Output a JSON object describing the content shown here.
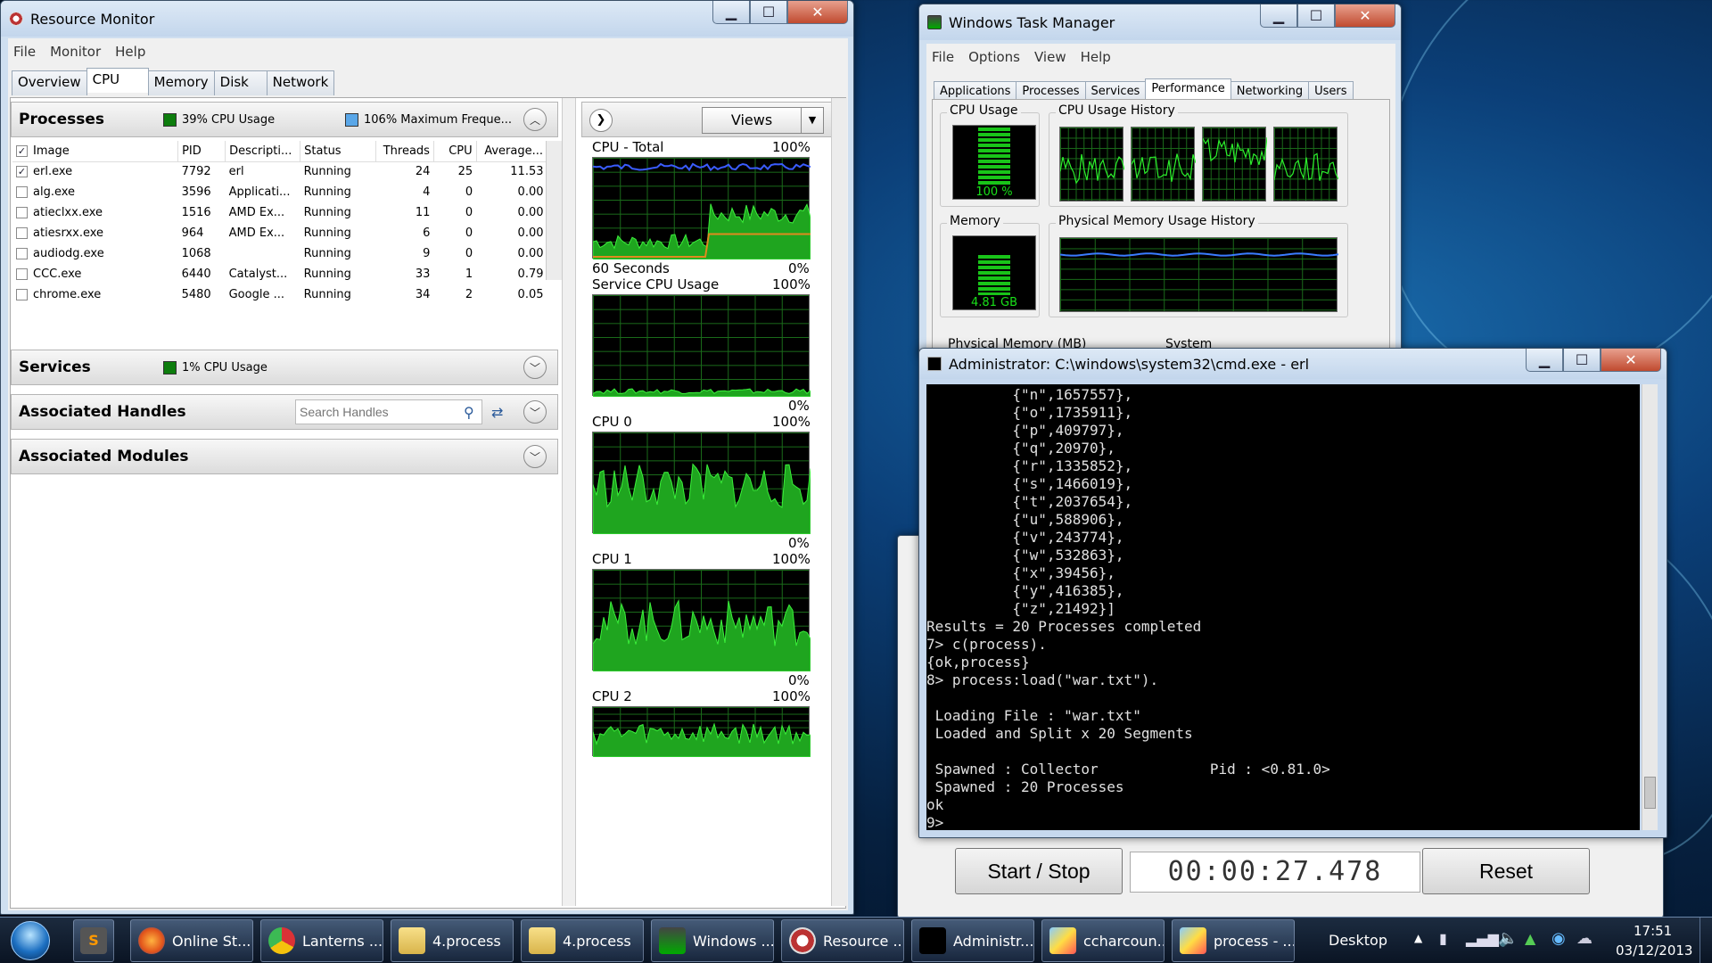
{
  "colors": {
    "accent_green": "#19c419",
    "graph_orange": "#e08a1e",
    "graph_blue": "#3a5cff",
    "cpu_legend_green": "#0d7d0d",
    "freq_legend_blue": "#5aa7e8"
  },
  "resmon": {
    "title": "Resource Monitor",
    "menu": [
      "File",
      "Monitor",
      "Help"
    ],
    "tabs": [
      "Overview",
      "CPU",
      "Memory",
      "Disk",
      "Network"
    ],
    "processes": {
      "heading": "Processes",
      "cpu_usage": "39% CPU Usage",
      "max_freq": "106% Maximum Freque...",
      "columns": [
        "Image",
        "PID",
        "Descripti...",
        "Status",
        "Threads",
        "CPU",
        "Average..."
      ],
      "rows": [
        {
          "checked": true,
          "image": "erl.exe",
          "pid": "7792",
          "desc": "erl",
          "status": "Running",
          "threads": "24",
          "cpu": "25",
          "avg": "11.53"
        },
        {
          "checked": false,
          "image": "alg.exe",
          "pid": "3596",
          "desc": "Applicati...",
          "status": "Running",
          "threads": "4",
          "cpu": "0",
          "avg": "0.00"
        },
        {
          "checked": false,
          "image": "atieclxx.exe",
          "pid": "1516",
          "desc": "AMD Ex...",
          "status": "Running",
          "threads": "11",
          "cpu": "0",
          "avg": "0.00"
        },
        {
          "checked": false,
          "image": "atiesrxx.exe",
          "pid": "964",
          "desc": "AMD Ex...",
          "status": "Running",
          "threads": "6",
          "cpu": "0",
          "avg": "0.00"
        },
        {
          "checked": false,
          "image": "audiodg.exe",
          "pid": "1068",
          "desc": "",
          "status": "Running",
          "threads": "9",
          "cpu": "0",
          "avg": "0.00"
        },
        {
          "checked": false,
          "image": "CCC.exe",
          "pid": "6440",
          "desc": "Catalyst...",
          "status": "Running",
          "threads": "33",
          "cpu": "1",
          "avg": "0.79"
        },
        {
          "checked": false,
          "image": "chrome.exe",
          "pid": "5480",
          "desc": "Google ...",
          "status": "Running",
          "threads": "34",
          "cpu": "2",
          "avg": "0.05"
        }
      ]
    },
    "services": {
      "heading": "Services",
      "cpu_usage": "1% CPU Usage"
    },
    "handles": {
      "heading": "Associated Handles",
      "search_placeholder": "Search Handles"
    },
    "modules": {
      "heading": "Associated Modules"
    },
    "views_label": "Views",
    "graphs": [
      {
        "title": "CPU - Total",
        "max": "100%",
        "bottom_left": "60 Seconds",
        "min": "0%"
      },
      {
        "title": "Service CPU Usage",
        "max": "100%",
        "bottom_left": "",
        "min": "0%"
      },
      {
        "title": "CPU 0",
        "max": "100%",
        "bottom_left": "",
        "min": "0%"
      },
      {
        "title": "CPU 1",
        "max": "100%",
        "bottom_left": "",
        "min": "0%"
      },
      {
        "title": "CPU 2",
        "max": "100%",
        "bottom_left": "",
        "min": ""
      }
    ]
  },
  "taskmgr": {
    "title": "Windows Task Manager",
    "menu": [
      "File",
      "Options",
      "View",
      "Help"
    ],
    "tabs": [
      "Applications",
      "Processes",
      "Services",
      "Performance",
      "Networking",
      "Users"
    ],
    "cpu_usage_label": "CPU Usage",
    "cpu_usage_value": "100 %",
    "cpu_usage_level": 1.0,
    "cpu_history_label": "CPU Usage History",
    "memory_label": "Memory",
    "memory_value": "4.81 GB",
    "memory_level": 0.7,
    "mem_history_label": "Physical Memory Usage History",
    "phys_mem_label": "Physical Memory (MB)",
    "system_label": "System"
  },
  "cmd": {
    "title": "Administrator: C:\\windows\\system32\\cmd.exe - erl",
    "lines": [
      "          {\"n\",1657557},",
      "          {\"o\",1735911},",
      "          {\"p\",409797},",
      "          {\"q\",20970},",
      "          {\"r\",1335852},",
      "          {\"s\",1466019},",
      "          {\"t\",2037654},",
      "          {\"u\",588906},",
      "          {\"v\",243774},",
      "          {\"w\",532863},",
      "          {\"x\",39456},",
      "          {\"y\",416385},",
      "          {\"z\",21492}]",
      "Results = 20 Processes completed",
      "7> c(process).",
      "{ok,process}",
      "8> process:load(\"war.txt\").",
      "",
      " Loading File : \"war.txt\"",
      " Loaded and Split x 20 Segments",
      "",
      " Spawned : Collector             Pid : <0.81.0>",
      " Spawned : 20 Processes",
      "ok",
      "9>"
    ]
  },
  "stopwatch": {
    "start_stop": "Start / Stop",
    "time": "00:00:27.478",
    "reset": "Reset"
  },
  "taskbar": {
    "buttons": [
      "Online St...",
      "Lanterns ...",
      "4.process",
      "4.process",
      "Windows ...",
      "Resource ...",
      "Administr...",
      "ccharcoun...",
      "process - ..."
    ],
    "desktop_label": "Desktop",
    "clock_time": "17:51",
    "clock_date": "03/12/2013"
  }
}
